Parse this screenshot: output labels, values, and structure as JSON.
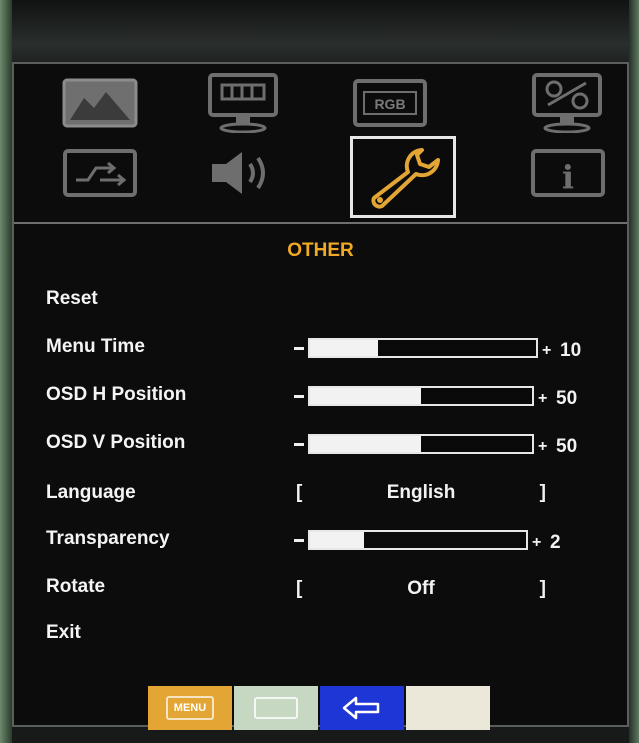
{
  "tabs_row1": [
    {
      "icon": "picture-icon"
    },
    {
      "icon": "display-icon"
    },
    {
      "icon": "rgb-icon",
      "label": "RGB"
    },
    {
      "icon": "percent-monitor-icon"
    }
  ],
  "tabs_row2": [
    {
      "icon": "input-switch-icon"
    },
    {
      "icon": "speaker-icon"
    },
    {
      "icon": "wrench-icon",
      "selected": true
    },
    {
      "icon": "info-icon",
      "label": "i"
    }
  ],
  "menu": {
    "title": "OTHER",
    "items": [
      {
        "label": "Reset"
      },
      {
        "label": "Menu Time",
        "type": "slider",
        "value": "10",
        "fraction": 0.3
      },
      {
        "label": "OSD H Position",
        "type": "slider",
        "value": "50",
        "fraction": 0.5
      },
      {
        "label": "OSD V Position",
        "type": "slider",
        "value": "50",
        "fraction": 0.5
      },
      {
        "label": "Language",
        "type": "choice",
        "value": "English"
      },
      {
        "label": "Transparency",
        "type": "slider",
        "value": "2",
        "fraction": 0.25
      },
      {
        "label": "Rotate",
        "type": "choice",
        "value": "Off"
      },
      {
        "label": "Exit"
      }
    ],
    "minus_symbol": "-",
    "plus_symbol": "+",
    "bracket_left": "[",
    "bracket_right": "]"
  },
  "bottom_buttons": [
    {
      "icon": "menu-key-icon",
      "label": "MENU",
      "color": "#e3a634"
    },
    {
      "icon": "select-key-icon",
      "label": "",
      "color": "#c6d7c2"
    },
    {
      "icon": "back-arrow-icon",
      "color": "#1f36d6"
    },
    {
      "icon": "blank-key-icon",
      "color": "#ece8d9"
    }
  ],
  "colors": {
    "accent": "#f0a925",
    "text": "#f4f4f4"
  }
}
